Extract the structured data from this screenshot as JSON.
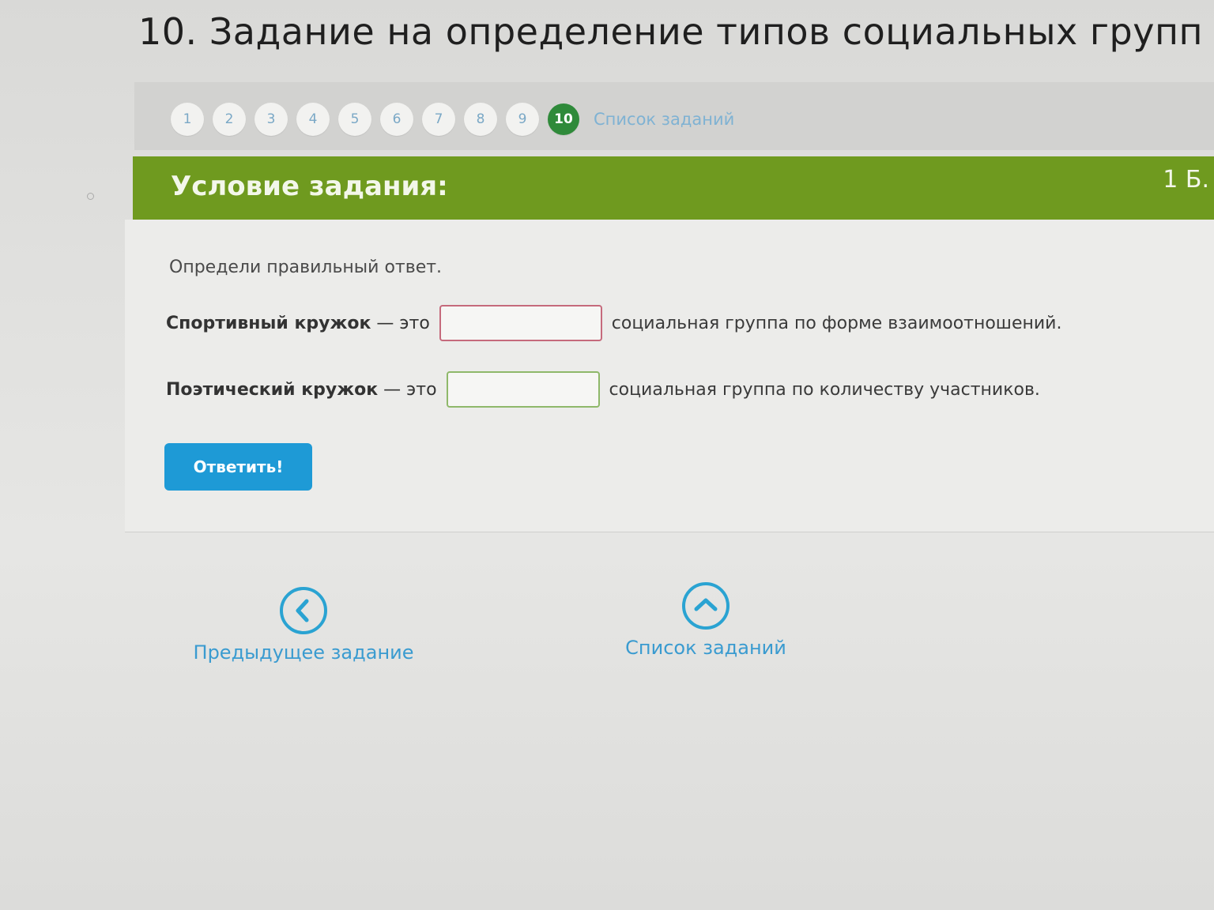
{
  "page": {
    "title": "10. Задание на определение типов социальных групп"
  },
  "pager": {
    "pages": [
      "1",
      "2",
      "3",
      "4",
      "5",
      "6",
      "7",
      "8",
      "9",
      "10"
    ],
    "current": "10",
    "task_list_link": "Список заданий"
  },
  "header": {
    "title": "Условие задания:",
    "score": "1 Б."
  },
  "task": {
    "instruction": "Определи правильный ответ.",
    "row1": {
      "prefix_bold": "Спортивный кружок",
      "prefix_light": " — это",
      "value": "",
      "suffix": "социальная группа по форме взаимоотношений."
    },
    "row2": {
      "prefix_bold": "Поэтический кружок",
      "prefix_light": " — это",
      "value": "",
      "suffix": "социальная группа по количеству участников."
    },
    "submit_label": "Ответить!"
  },
  "nav": {
    "prev_label": "Предыдущее задание",
    "list_label": "Список заданий"
  },
  "colors": {
    "header_green": "#6f9a1f",
    "current_page": "#2f8a3a",
    "button_blue": "#1e9ad6",
    "link_blue": "#3a9bd0"
  }
}
